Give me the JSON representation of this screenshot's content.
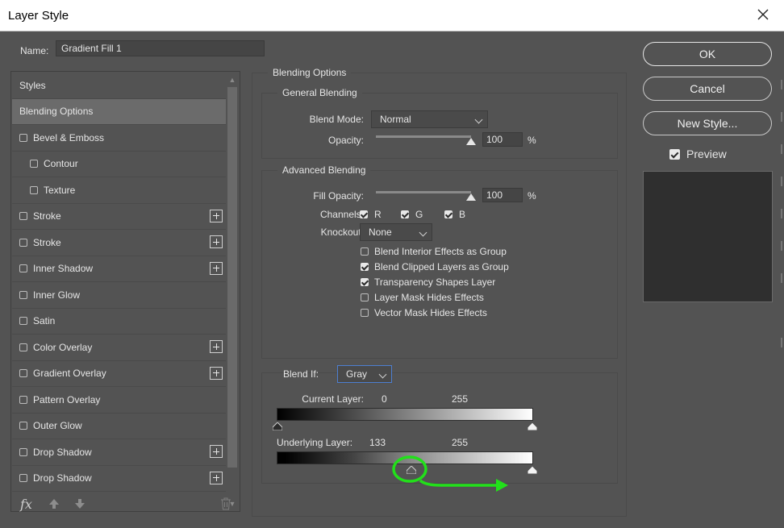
{
  "window": {
    "title": "Layer Style",
    "close_icon": "close-icon"
  },
  "name": {
    "label": "Name:",
    "value": "Gradient Fill 1"
  },
  "styles": {
    "items": [
      {
        "label": "Styles",
        "header": true
      },
      {
        "label": "Blending Options",
        "selected": true
      },
      {
        "label": "Bevel & Emboss",
        "checkbox": true
      },
      {
        "label": "Contour",
        "checkbox": true,
        "indent": true
      },
      {
        "label": "Texture",
        "checkbox": true,
        "indent": true
      },
      {
        "label": "Stroke",
        "checkbox": true,
        "plus": true
      },
      {
        "label": "Stroke",
        "checkbox": true,
        "plus": true
      },
      {
        "label": "Inner Shadow",
        "checkbox": true,
        "plus": true
      },
      {
        "label": "Inner Glow",
        "checkbox": true
      },
      {
        "label": "Satin",
        "checkbox": true
      },
      {
        "label": "Color Overlay",
        "checkbox": true,
        "plus": true
      },
      {
        "label": "Gradient Overlay",
        "checkbox": true,
        "plus": true
      },
      {
        "label": "Pattern Overlay",
        "checkbox": true
      },
      {
        "label": "Outer Glow",
        "checkbox": true
      },
      {
        "label": "Drop Shadow",
        "checkbox": true,
        "plus": true
      },
      {
        "label": "Drop Shadow",
        "checkbox": true,
        "plus": true
      }
    ],
    "fx_label": "fx"
  },
  "blending_options": {
    "title": "Blending Options",
    "general": {
      "title": "General Blending",
      "blend_mode_label": "Blend Mode:",
      "blend_mode_value": "Normal",
      "opacity_label": "Opacity:",
      "opacity_value": "100",
      "opacity_unit": "%",
      "opacity_level": 1.0
    },
    "advanced": {
      "title": "Advanced Blending",
      "fill_opacity_label": "Fill Opacity:",
      "fill_opacity_value": "100",
      "fill_opacity_unit": "%",
      "fill_opacity_level": 1.0,
      "channels_label": "Channels:",
      "channels": [
        {
          "label": "R",
          "checked": true
        },
        {
          "label": "G",
          "checked": true
        },
        {
          "label": "B",
          "checked": true
        }
      ],
      "knockout_label": "Knockout:",
      "knockout_value": "None",
      "options": [
        {
          "label": "Blend Interior Effects as Group",
          "checked": false
        },
        {
          "label": "Blend Clipped Layers as Group",
          "checked": true
        },
        {
          "label": "Transparency Shapes Layer",
          "checked": true
        },
        {
          "label": "Layer Mask Hides Effects",
          "checked": false
        },
        {
          "label": "Vector Mask Hides Effects",
          "checked": false
        }
      ]
    },
    "blend_if": {
      "label": "Blend If:",
      "value": "Gray",
      "current_layer": {
        "label": "Current Layer:",
        "low": "0",
        "high": "255"
      },
      "underlying_layer": {
        "label": "Underlying Layer:",
        "low": "133",
        "high": "255"
      }
    }
  },
  "buttons": {
    "ok": "OK",
    "cancel": "Cancel",
    "new_style": "New Style..."
  },
  "preview": {
    "label": "Preview",
    "checked": true
  },
  "annotation": {
    "color": "#22e01a"
  }
}
